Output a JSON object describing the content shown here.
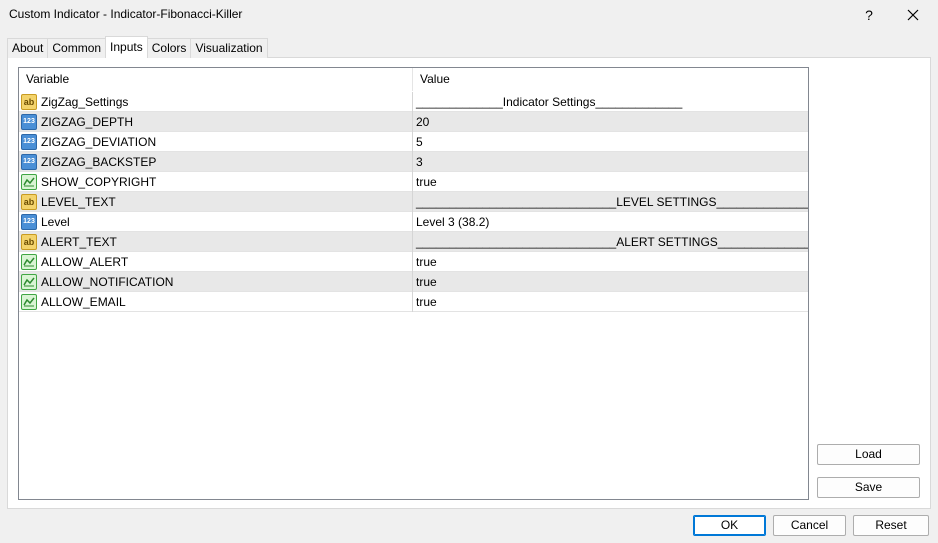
{
  "window": {
    "title": "Custom Indicator - Indicator-Fibonacci-Killer",
    "help_label": "?",
    "close_label": "✕"
  },
  "tabs": [
    {
      "label": "About",
      "active": false
    },
    {
      "label": "Common",
      "active": false
    },
    {
      "label": "Inputs",
      "active": true
    },
    {
      "label": "Colors",
      "active": false
    },
    {
      "label": "Visualization",
      "active": false
    }
  ],
  "grid": {
    "header": {
      "variable": "Variable",
      "value": "Value"
    },
    "rows": [
      {
        "type": "ab",
        "icon": "string-icon",
        "variable": "ZigZag_Settings",
        "value": "_____________Indicator Settings_____________"
      },
      {
        "type": "num",
        "icon": "number-icon",
        "variable": "ZIGZAG_DEPTH",
        "value": "20"
      },
      {
        "type": "num",
        "icon": "number-icon",
        "variable": "ZIGZAG_DEVIATION",
        "value": "5"
      },
      {
        "type": "num",
        "icon": "number-icon",
        "variable": "ZIGZAG_BACKSTEP",
        "value": "3"
      },
      {
        "type": "bool",
        "icon": "boolean-icon",
        "variable": "SHOW_COPYRIGHT",
        "value": "true"
      },
      {
        "type": "ab",
        "icon": "string-icon",
        "variable": "LEVEL_TEXT",
        "value": "______________________________LEVEL SETTINGS________________..."
      },
      {
        "type": "num",
        "icon": "number-icon",
        "variable": "Level",
        "value": "Level 3 (38.2)"
      },
      {
        "type": "ab",
        "icon": "string-icon",
        "variable": "ALERT_TEXT",
        "value": "______________________________ALERT SETTINGS_______________..."
      },
      {
        "type": "bool",
        "icon": "boolean-icon",
        "variable": "ALLOW_ALERT",
        "value": "true"
      },
      {
        "type": "bool",
        "icon": "boolean-icon",
        "variable": "ALLOW_NOTIFICATION",
        "value": "true"
      },
      {
        "type": "bool",
        "icon": "boolean-icon",
        "variable": "ALLOW_EMAIL",
        "value": "true"
      }
    ]
  },
  "buttons": {
    "load": "Load",
    "save": "Save",
    "ok": "OK",
    "cancel": "Cancel",
    "reset": "Reset"
  },
  "icon_text": {
    "ab": "ab",
    "num": "123"
  }
}
